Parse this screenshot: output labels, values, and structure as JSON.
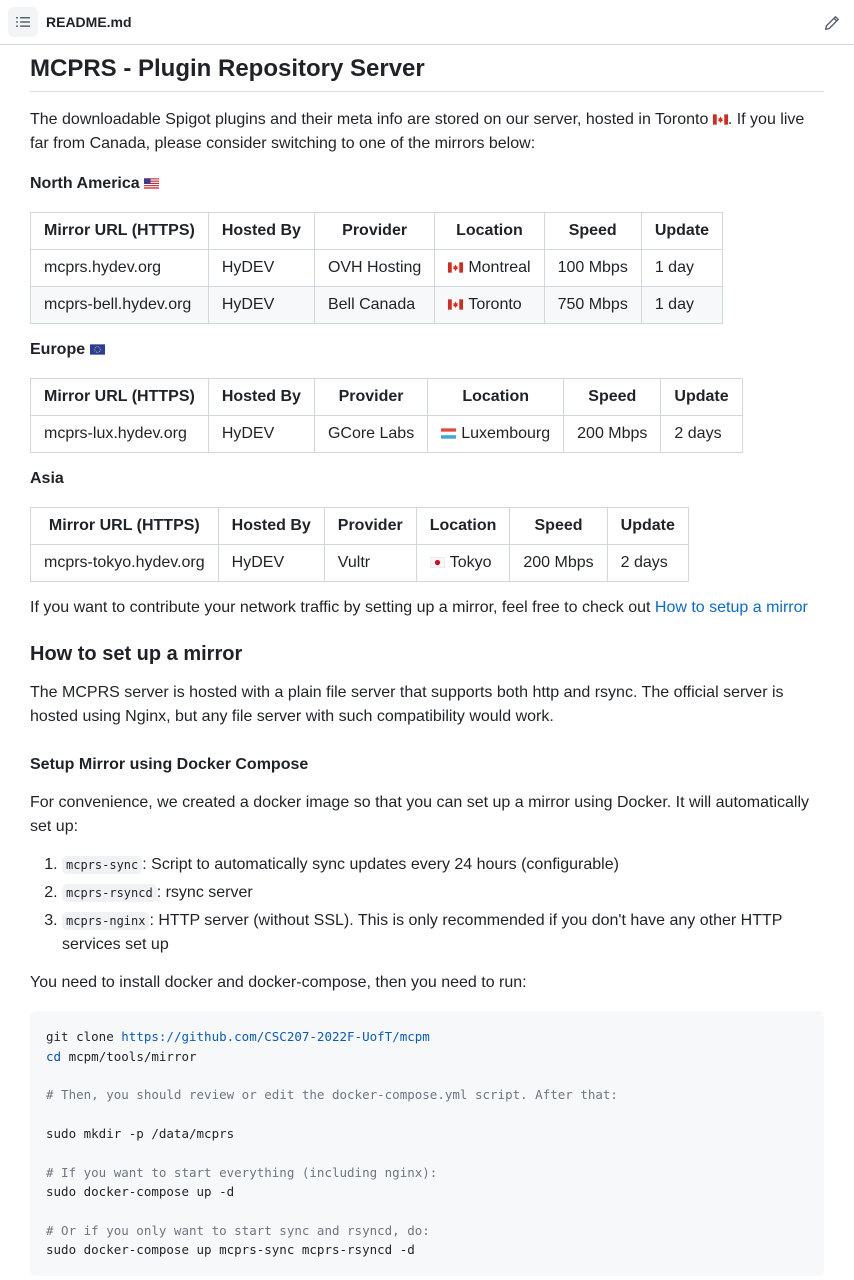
{
  "header": {
    "filename": "README.md"
  },
  "doc": {
    "title": "MCPRS - Plugin Repository Server",
    "intro_part1": "The downloadable Spigot plugins and their meta info are stored on our server, hosted in Toronto ",
    "intro_part2": ". If you live far from Canada, please consider switching to one of the mirrors below:",
    "table_headers": [
      "Mirror URL (HTTPS)",
      "Hosted By",
      "Provider",
      "Location",
      "Speed",
      "Update"
    ],
    "na_title": "North America",
    "na_rows": [
      {
        "url": "mcprs.hydev.org",
        "host": "HyDEV",
        "provider": "OVH Hosting",
        "location": "Montreal",
        "speed": "100 Mbps",
        "update": "1 day"
      },
      {
        "url": "mcprs-bell.hydev.org",
        "host": "HyDEV",
        "provider": "Bell Canada",
        "location": "Toronto",
        "speed": "750 Mbps",
        "update": "1 day"
      }
    ],
    "eu_title": "Europe",
    "eu_rows": [
      {
        "url": "mcprs-lux.hydev.org",
        "host": "HyDEV",
        "provider": "GCore Labs",
        "location": "Luxembourg",
        "speed": "200 Mbps",
        "update": "2 days"
      }
    ],
    "asia_title": "Asia",
    "asia_rows": [
      {
        "url": "mcprs-tokyo.hydev.org",
        "host": "HyDEV",
        "provider": "Vultr",
        "location": "Tokyo",
        "speed": "200 Mbps",
        "update": "2 days"
      }
    ],
    "contribute_text": "If you want to contribute your network traffic by setting up a mirror, feel free to check out ",
    "contribute_link": "How to setup a mirror",
    "howto_title": "How to set up a mirror",
    "howto_text": "The MCPRS server is hosted with a plain file server that supports both http and rsync. The official server is hosted using Nginx, but any file server with such compatibility would work.",
    "docker_title": "Setup Mirror using Docker Compose",
    "docker_text": "For convenience, we created a docker image so that you can set up a mirror using Docker. It will automatically set up:",
    "steps": [
      {
        "code": "mcprs-sync",
        "text": ": Script to automatically sync updates every 24 hours (configurable)"
      },
      {
        "code": "mcprs-rsyncd",
        "text": ": rsync server"
      },
      {
        "code": "mcprs-nginx",
        "text": ": HTTP server (without SSL). This is only recommended if you don't have any other HTTP services set up"
      }
    ],
    "install_text": "You need to install docker and docker-compose, then you need to run:",
    "code": {
      "line1_cmd": "git clone ",
      "line1_url": "https://github.com/CSC207-2022F-UofT/mcpm",
      "line2_kw": "cd",
      "line2_rest": " mcpm/tools/mirror",
      "comment1": "# Then, you should review or edit the docker-compose.yml script. After that:",
      "mkdir": "sudo mkdir -p /data/mcprs",
      "comment2": "# If you want to start everything (including nginx):",
      "up_all": "sudo docker-compose up -d",
      "comment3": "# Or if you only want to start sync and rsyncd, do:",
      "up_some": "sudo docker-compose up mcprs-sync mcprs-rsyncd -d"
    }
  },
  "colors": {
    "link": "#0969da",
    "border": "#d0d7de",
    "code_bg": "#f6f8fa"
  },
  "icons": {
    "toc": "list-unordered-icon",
    "edit": "pencil-icon"
  }
}
